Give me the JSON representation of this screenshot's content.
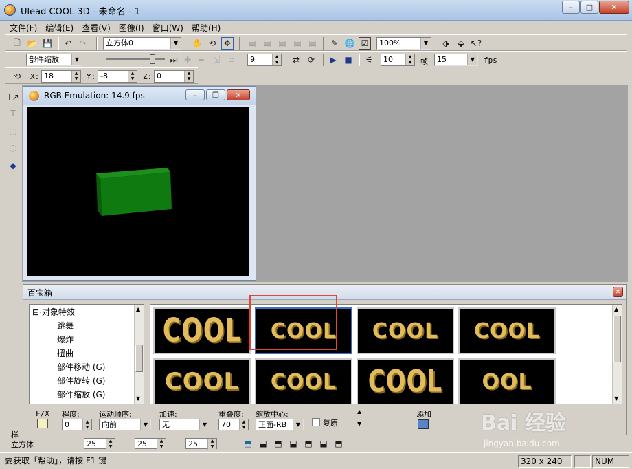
{
  "window": {
    "title": "Ulead COOL 3D - 未命名 - 1"
  },
  "menu": [
    "文件(F)",
    "编辑(E)",
    "查看(V)",
    "图像(I)",
    "窗口(W)",
    "帮助(H)"
  ],
  "toolbar1": {
    "object_combo": "立方体0",
    "zoom_combo": "100%"
  },
  "toolbar2": {
    "effect_combo": "部件缩放",
    "frame_value": "9",
    "frames_total": "10",
    "frames_label": "帧",
    "fps_value": "15",
    "fps_label": "fps"
  },
  "toolbar3": {
    "x_label": "X:",
    "x_value": "18",
    "y_label": "Y:",
    "y_value": "-8",
    "z_label": "Z:",
    "z_value": "0"
  },
  "rgb_window": {
    "title": "RGB Emulation: 14.9 fps"
  },
  "easy_palette": {
    "title": "百宝箱",
    "tree": {
      "root": "对象特效",
      "items": [
        "跳舞",
        "爆炸",
        "扭曲",
        "部件移动 (G)",
        "部件旋转 (G)",
        "部件缩放 (G)"
      ]
    },
    "thumbnails": [
      "COOL",
      "COOL",
      "COOL",
      "COOL",
      "COOL",
      "COOL",
      "COOL",
      "OOL"
    ],
    "props": {
      "fx_label": "F/X",
      "degree_label": "程度:",
      "degree_value": "0",
      "order_label": "运动顺序:",
      "order_value": "向前",
      "accel_label": "加速:",
      "accel_value": "无",
      "overlap_label": "重叠度:",
      "overlap_value": "70",
      "center_label": "缩放中心:",
      "center_value": "正面-RB",
      "restore_label": "复原",
      "add_label": "添加"
    }
  },
  "bottom": {
    "style_label": "样",
    "shape_label": "立方体",
    "v1": "25",
    "v2": "25",
    "v3": "25"
  },
  "status": {
    "help": "要获取「帮助」，请按 F1 键",
    "size": "320 x 240",
    "num": "NUM"
  },
  "watermark": {
    "brand": "Bai 经验",
    "url": "jingyan.baidu.com"
  }
}
